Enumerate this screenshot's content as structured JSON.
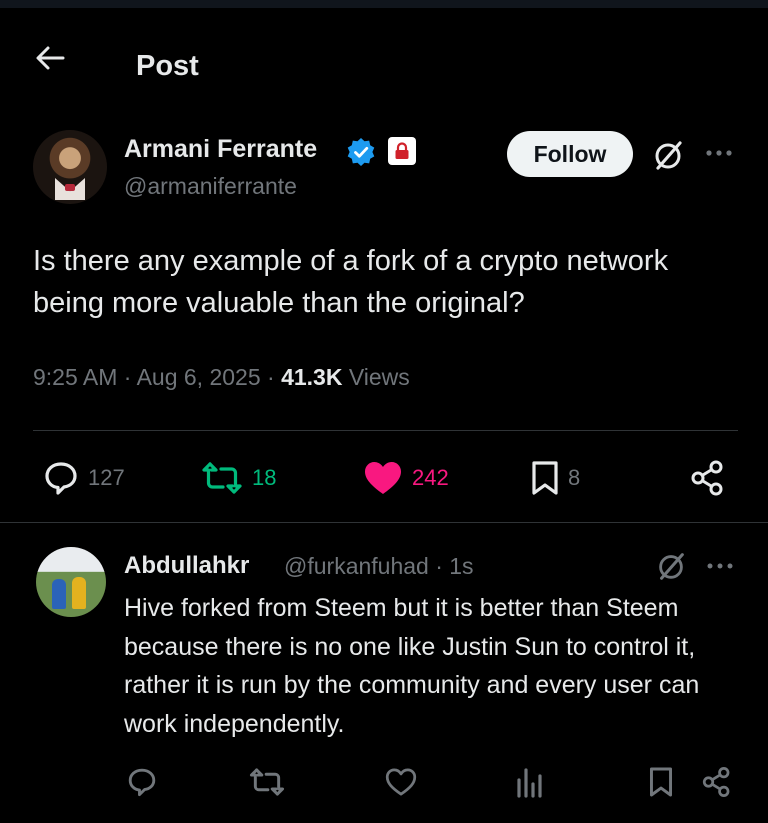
{
  "header": {
    "back_icon": "arrow-left-icon",
    "title": "Post"
  },
  "post": {
    "author": {
      "name": "Armani Ferrante",
      "handle": "@armaniferrante",
      "verified_icon": "verified-badge-icon",
      "affiliation_icon": "lock-badge-icon"
    },
    "follow_label": "Follow",
    "text": "Is there any example of a fork of a crypto network being more valuable than the original?",
    "meta": {
      "time": "9:25 AM",
      "date": "Aug 6, 2025",
      "views_count": "41.3K",
      "views_label": "Views"
    },
    "actions": {
      "replies": "127",
      "reposts": "18",
      "likes": "242",
      "bookmarks": "8"
    },
    "colors": {
      "repost_green": "#00ba7c",
      "like_pink": "#f91880",
      "verified_blue": "#1d9bf0",
      "badge_red": "#d0212a"
    }
  },
  "reply": {
    "name": "Abdullahkr",
    "handle_time": "@furkanfuhad · 1s",
    "text": "Hive forked from Steem but it is better than Steem because there is no one like Justin Sun to control it, rather it is run by the community and every user can work independently."
  }
}
